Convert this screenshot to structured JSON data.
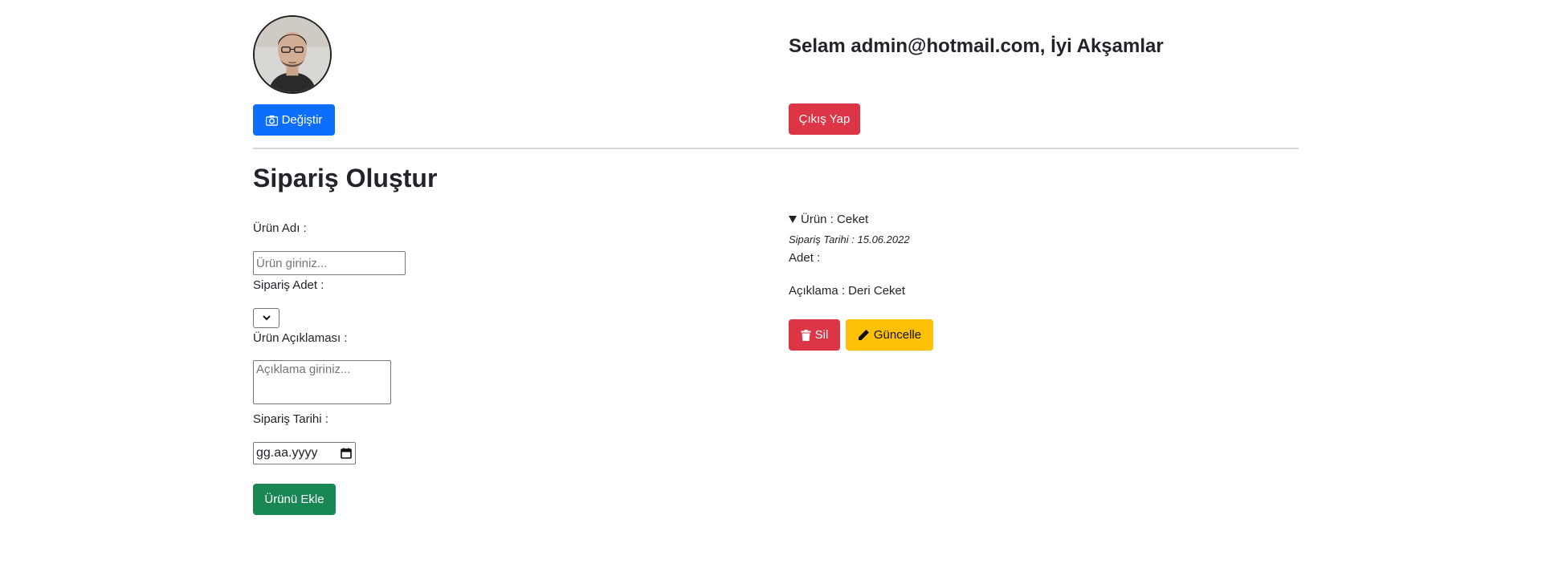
{
  "profile": {
    "change_label": "Değiştir",
    "camera_icon": "camera-icon",
    "greeting": "Selam admin@hotmail.com, İyi Akşamlar",
    "logout_label": "Çıkış Yap"
  },
  "form": {
    "title": "Sipariş Oluştur",
    "name_label": "Ürün Adı :",
    "name_placeholder": "Ürün giriniz...",
    "qty_label": "Sipariş Adet :",
    "desc_label": "Ürün Açıklaması :",
    "desc_placeholder": "Açıklama giriniz...",
    "date_label": "Sipariş Tarihi :",
    "date_placeholder": "gg.aa.yyyy",
    "submit_label": "Ürünü Ekle"
  },
  "order": {
    "summary": "Ürün : Ceket",
    "date": "Sipariş Tarihi : 15.06.2022",
    "quantity": "Adet :",
    "description": "Açıklama : Deri Ceket",
    "delete_label": "Sil",
    "update_label": "Güncelle"
  },
  "colors": {
    "primary": "#0d6efd",
    "danger": "#dc3545",
    "success": "#198754",
    "warning": "#ffc107"
  }
}
